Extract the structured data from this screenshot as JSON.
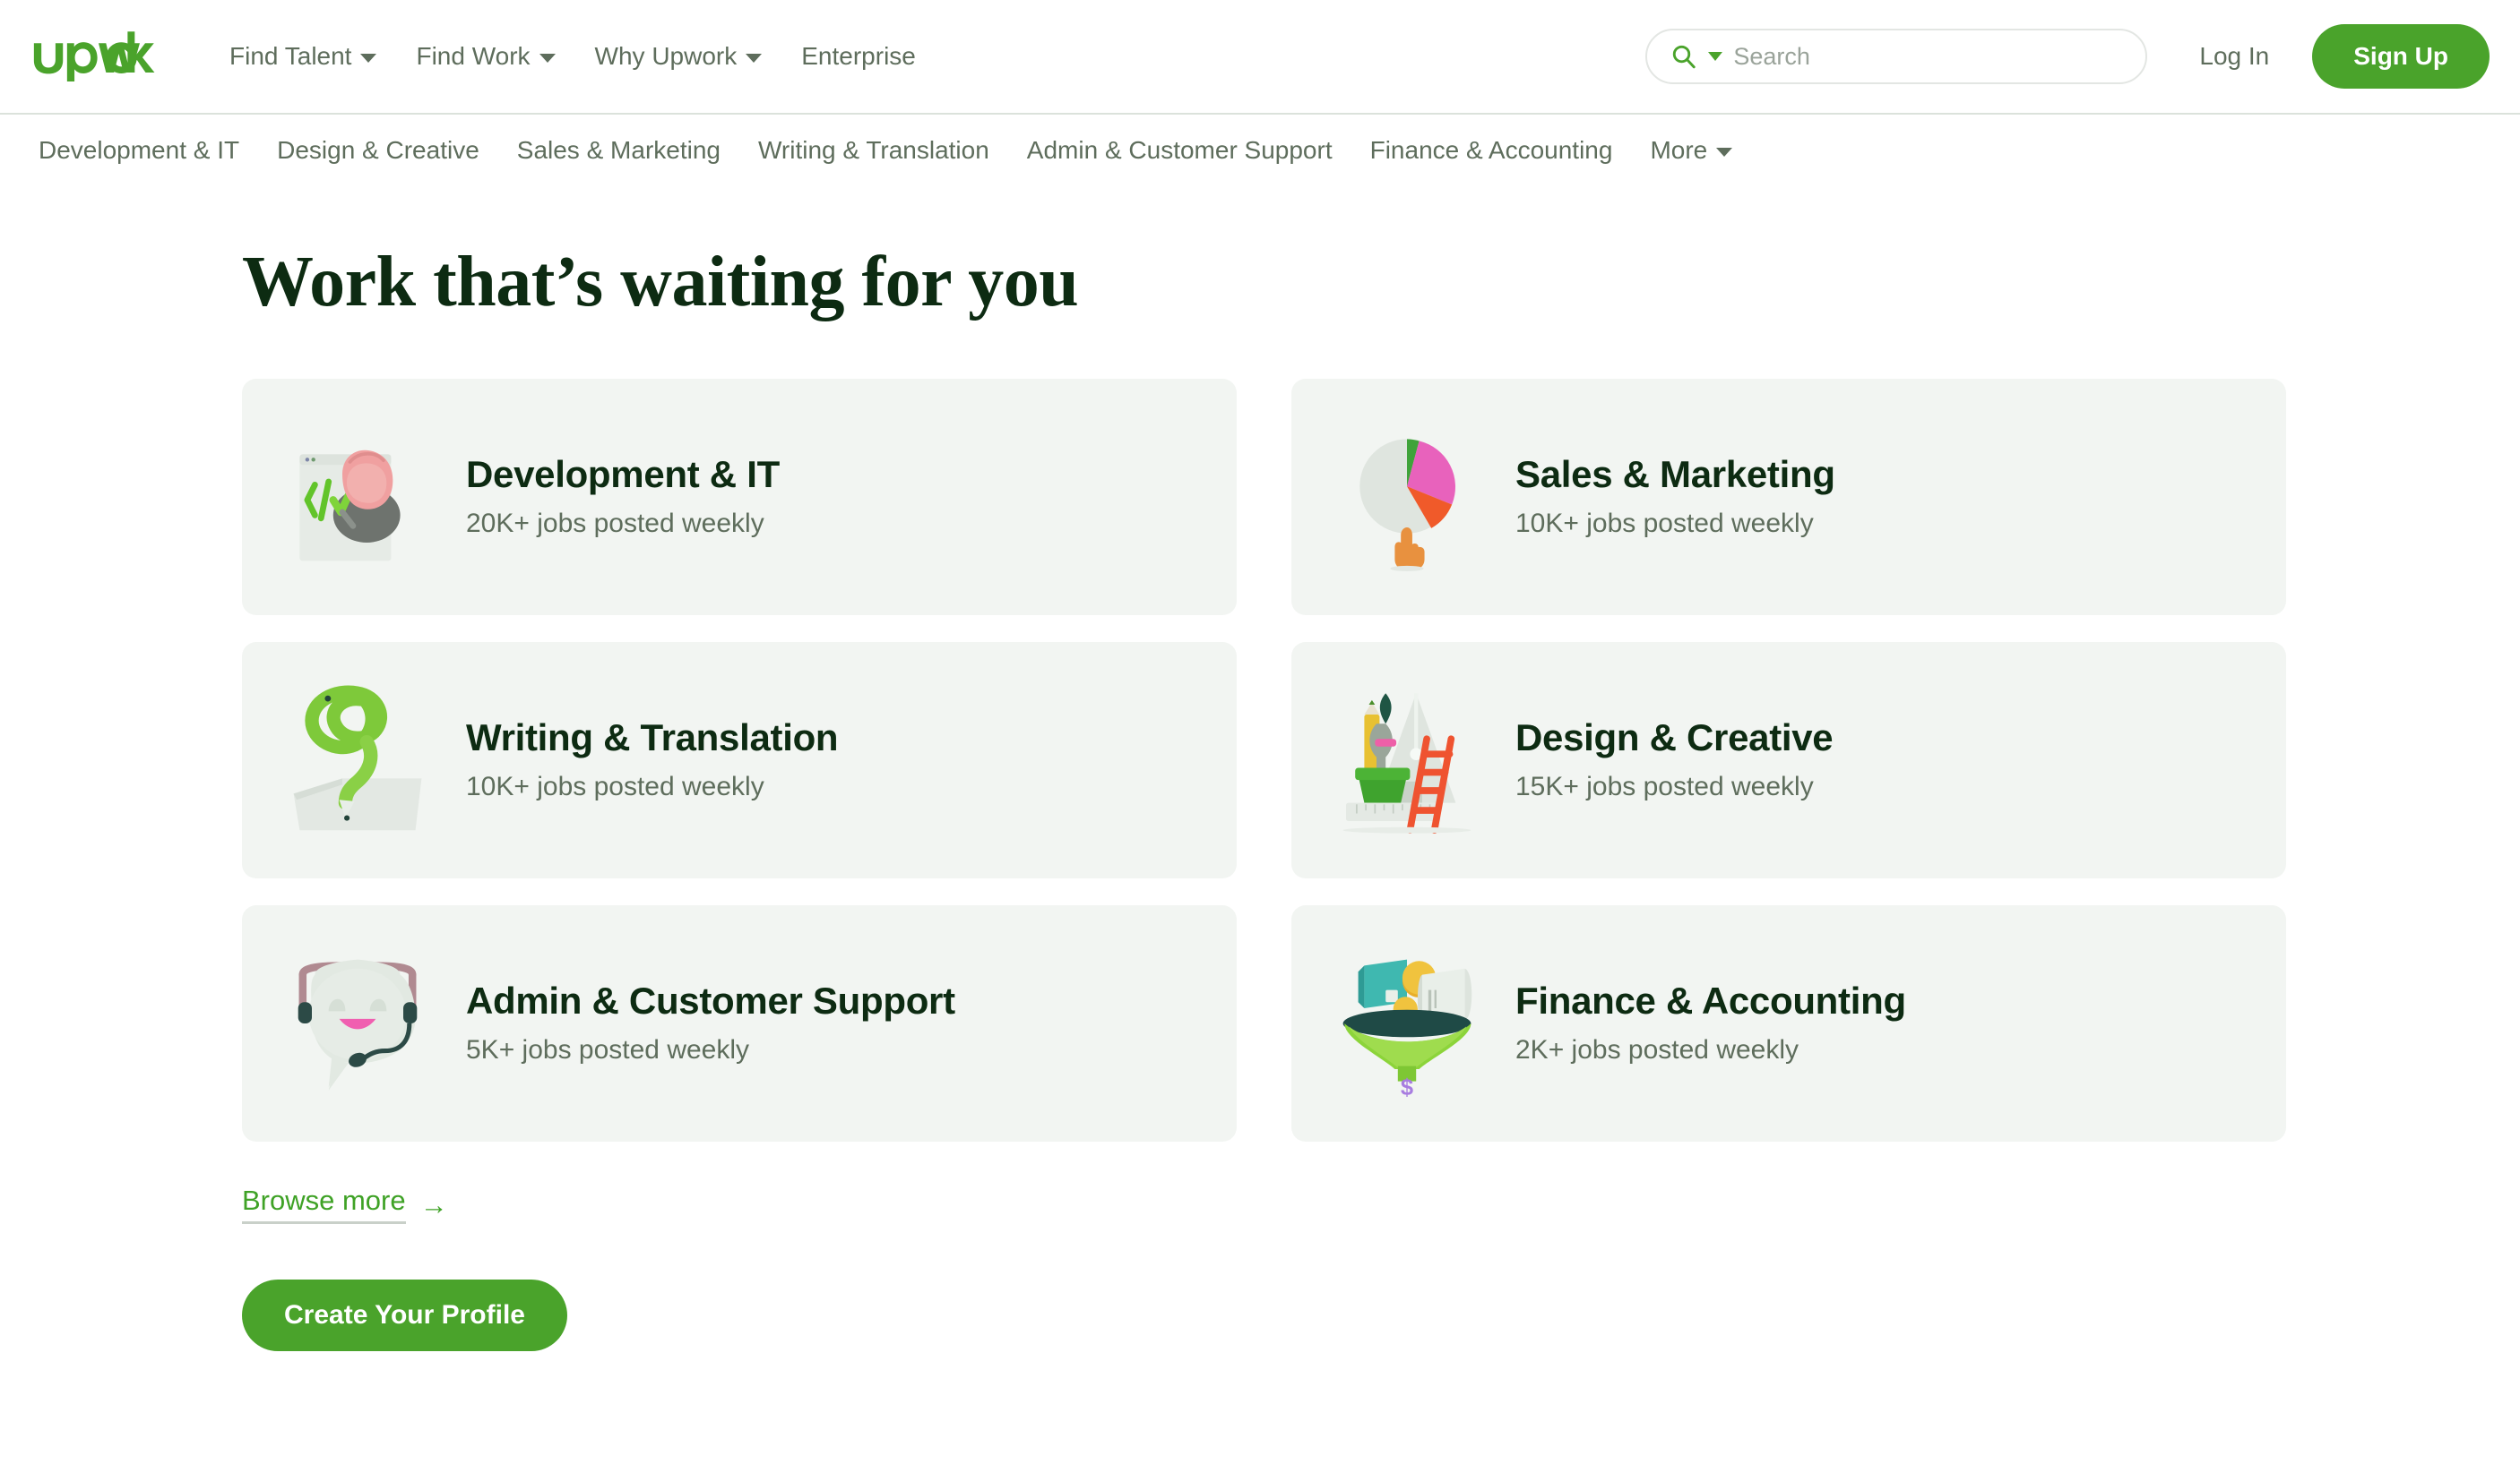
{
  "header": {
    "logo_text": "upwork",
    "logo_color": "#4aa32b",
    "nav": [
      {
        "label": "Find Talent",
        "has_caret": true
      },
      {
        "label": "Find Work",
        "has_caret": true
      },
      {
        "label": "Why Upwork",
        "has_caret": true
      },
      {
        "label": "Enterprise",
        "has_caret": false
      }
    ],
    "search": {
      "icon": "search-icon",
      "placeholder": "Search",
      "value": ""
    },
    "login_label": "Log In",
    "signup_label": "Sign Up",
    "signup_color": "#4aa32b"
  },
  "category_nav": [
    {
      "label": "Development & IT",
      "has_caret": false
    },
    {
      "label": "Design & Creative",
      "has_caret": false
    },
    {
      "label": "Sales & Marketing",
      "has_caret": false
    },
    {
      "label": "Writing & Translation",
      "has_caret": false
    },
    {
      "label": "Admin & Customer Support",
      "has_caret": false
    },
    {
      "label": "Finance & Accounting",
      "has_caret": false
    },
    {
      "label": "More",
      "has_caret": true
    }
  ],
  "main": {
    "title": "Work that’s waiting for you",
    "cards": [
      {
        "title": "Development & IT",
        "sub": "20K+ jobs posted weekly",
        "illustration": "code-window-hand-illustration"
      },
      {
        "title": "Sales & Marketing",
        "sub": "10K+ jobs posted weekly",
        "illustration": "pie-chart-fingertip-illustration"
      },
      {
        "title": "Writing & Translation",
        "sub": "10K+ jobs posted weekly",
        "illustration": "curled-pencil-paper-illustration"
      },
      {
        "title": "Design & Creative",
        "sub": "15K+ jobs posted weekly",
        "illustration": "pencil-pot-ladder-illustration"
      },
      {
        "title": "Admin & Customer Support",
        "sub": "5K+ jobs posted weekly",
        "illustration": "headset-speech-bubble-illustration"
      },
      {
        "title": "Finance & Accounting",
        "sub": "2K+ jobs posted weekly",
        "illustration": "funnel-coins-invoice-illustration"
      }
    ],
    "browse_more_label": "Browse more",
    "browse_more_arrow": "→",
    "cta_label": "Create Your Profile"
  },
  "colors": {
    "brand_green": "#4aa32b",
    "link_green": "#3fa226",
    "card_bg": "#f2f5f2",
    "title_dark": "#0d2b12",
    "muted_text": "#5e6d5c"
  }
}
